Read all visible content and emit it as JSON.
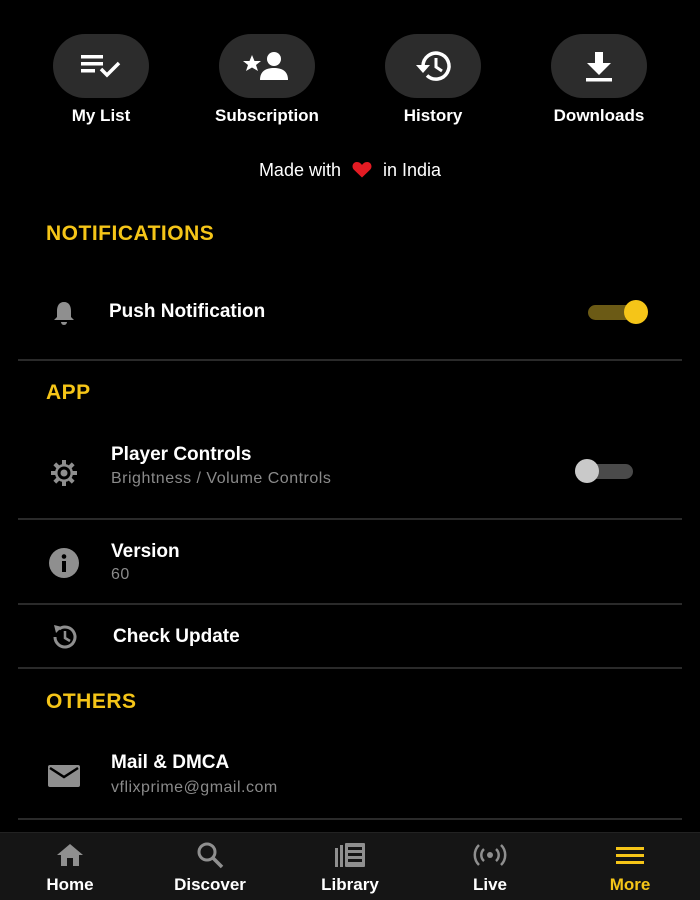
{
  "quick_actions": [
    {
      "label": "My List",
      "icon": "playlist-check-icon"
    },
    {
      "label": "Subscription",
      "icon": "person-star-icon"
    },
    {
      "label": "History",
      "icon": "history-icon"
    },
    {
      "label": "Downloads",
      "icon": "download-icon"
    }
  ],
  "made_with": {
    "prefix": "Made with",
    "suffix": "in India",
    "heart_color": "#e31b23"
  },
  "sections": {
    "notifications": {
      "title": "NOTIFICATIONS"
    },
    "app": {
      "title": "APP"
    },
    "others": {
      "title": "OTHERS"
    }
  },
  "settings": {
    "push_notification": {
      "title": "Push Notification",
      "enabled": true,
      "icon": "bell-icon"
    },
    "player_controls": {
      "title": "Player Controls",
      "subtitle": "Brightness / Volume Controls",
      "enabled": false,
      "icon": "gear-icon"
    },
    "version": {
      "title": "Version",
      "value": "60",
      "icon": "info-icon"
    },
    "check_update": {
      "title": "Check Update",
      "icon": "refresh-icon"
    },
    "mail": {
      "title": "Mail & DMCA",
      "value": "vflixprime@gmail.com",
      "icon": "mail-icon"
    }
  },
  "bottom_nav": [
    {
      "label": "Home",
      "icon": "home-icon",
      "active": false
    },
    {
      "label": "Discover",
      "icon": "search-icon",
      "active": false
    },
    {
      "label": "Library",
      "icon": "library-icon",
      "active": false
    },
    {
      "label": "Live",
      "icon": "live-broadcast-icon",
      "active": false
    },
    {
      "label": "More",
      "icon": "menu-icon",
      "active": true
    }
  ],
  "colors": {
    "accent": "#f5c518",
    "background": "#000000",
    "muted_text": "#8a8a8a"
  }
}
